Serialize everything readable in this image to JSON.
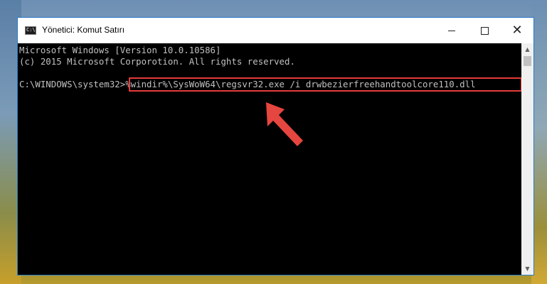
{
  "window": {
    "title": "Yönetici: Komut Satırı",
    "icon_label": "C:\\",
    "controls": {
      "minimize": "minimize",
      "maximize": "maximize",
      "close": "close"
    }
  },
  "console": {
    "line1": "Microsoft Windows [Version 10.0.10586]",
    "line2": "(c) 2015 Microsoft Corporotion. All rights reserved.",
    "prompt": "C:\\WINDOWS\\system32>",
    "command": "%windir%\\SysWoW64\\regsvr32.exe /i drwbezierfreehandtoolcore110.dll"
  },
  "colors": {
    "highlight": "#e43b3b",
    "console_bg": "#000000",
    "console_text": "#c0c0c0",
    "arrow": "#e5463f"
  },
  "icons": {
    "app": "cmd-icon",
    "scroll_up": "chevron-up-icon",
    "scroll_down": "chevron-down-icon",
    "annotation": "red-arrow-icon"
  }
}
